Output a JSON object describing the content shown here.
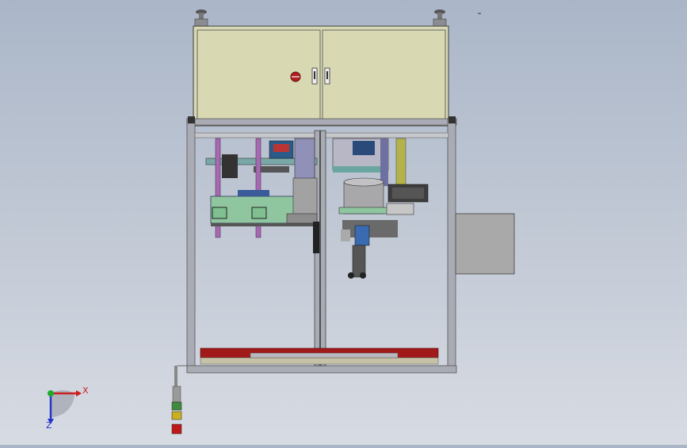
{
  "viewport": {
    "background_top": "#aab6c8",
    "background_bottom": "#d7dbe3"
  },
  "triad": {
    "x_label": "X",
    "y_label": "Y",
    "z_label": "Z",
    "x_color": "#cc1f1f",
    "y_color": "#1faa2a",
    "z_color": "#2535c8"
  },
  "colors": {
    "cabinet": "#d8d9b3",
    "frame": "#a9acb4",
    "plate_green": "#8fc6a0",
    "purple_rod": "#a56ab0",
    "red_base": "#a11a1a",
    "side_box": "#a9a9a9",
    "tower_green": "#3f8a3f",
    "tower_yellow": "#c8b020",
    "tower_red": "#c01818"
  },
  "icons": [
    "leveling-foot-icon",
    "lock-knob-icon",
    "door-handle-icon",
    "signal-tower-icon",
    "coordinate-triad-icon"
  ]
}
